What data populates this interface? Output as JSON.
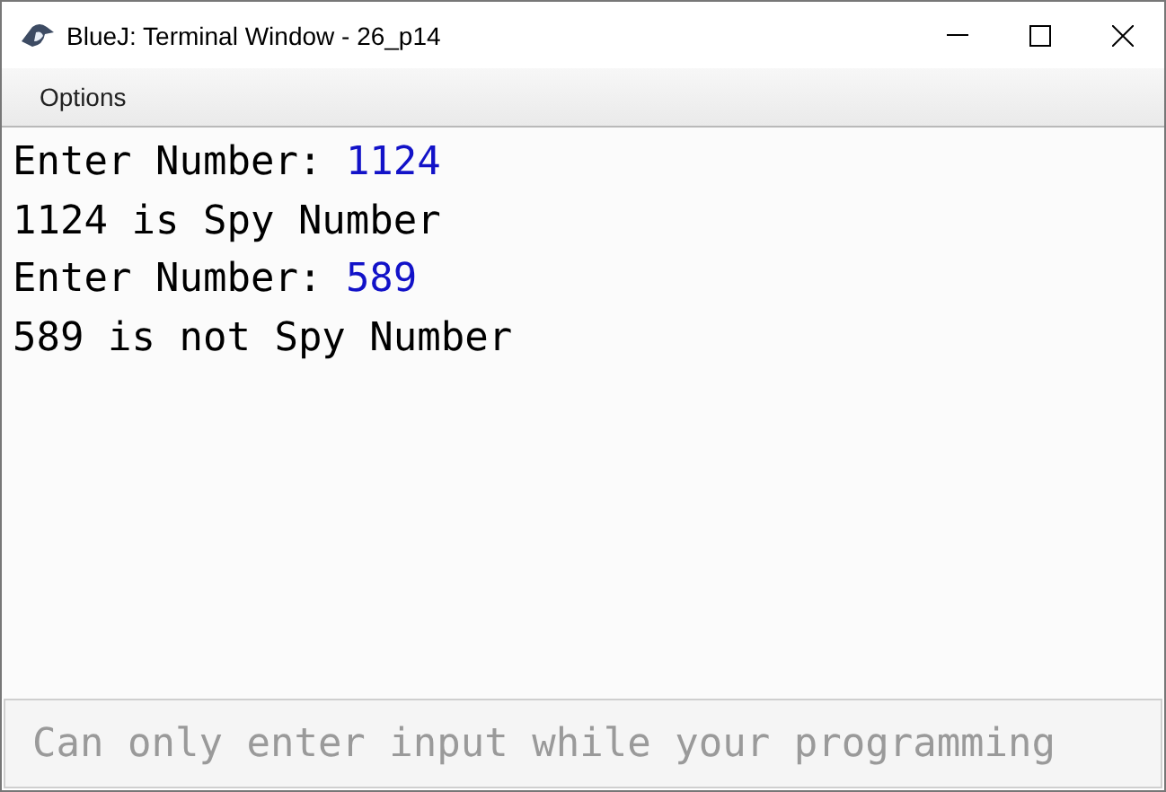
{
  "window": {
    "title": "BlueJ: Terminal Window - 26_p14"
  },
  "menu": [
    {
      "label": "Options"
    }
  ],
  "terminal": {
    "lines": [
      [
        {
          "kind": "output",
          "text": "Enter Number: "
        },
        {
          "kind": "input",
          "text": "1124"
        }
      ],
      [
        {
          "kind": "output",
          "text": "1124 is Spy Number"
        }
      ],
      [
        {
          "kind": "output",
          "text": "Enter Number: "
        },
        {
          "kind": "input",
          "text": "589"
        }
      ],
      [
        {
          "kind": "output",
          "text": "589 is not Spy Number"
        }
      ]
    ]
  },
  "input": {
    "placeholder": "Can only enter input while your programming"
  }
}
